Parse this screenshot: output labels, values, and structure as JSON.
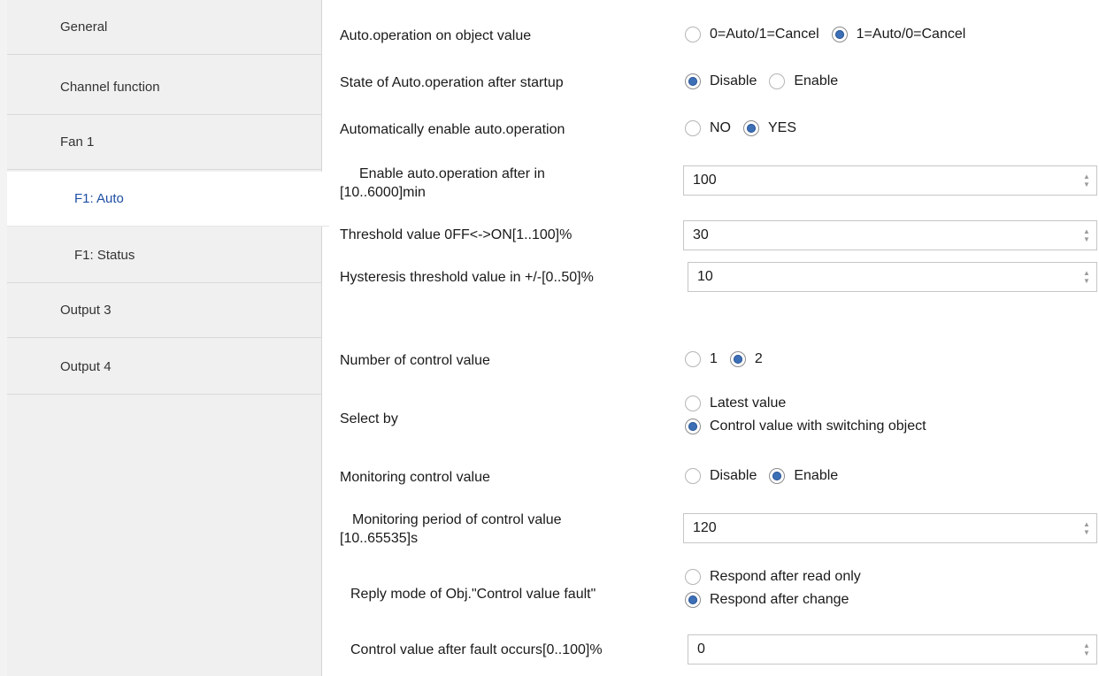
{
  "sidebar": {
    "items": [
      {
        "label": "General"
      },
      {
        "label": "Channel function"
      },
      {
        "label": "Fan 1"
      },
      {
        "label": "F1: Auto",
        "active": true
      },
      {
        "label": "F1: Status"
      },
      {
        "label": "Output 3"
      },
      {
        "label": "Output 4"
      }
    ]
  },
  "params": {
    "auto_op_object": {
      "label": "Auto.operation on object value",
      "options": [
        "0=Auto/1=Cancel",
        "1=Auto/0=Cancel"
      ],
      "selected": "1=Auto/0=Cancel"
    },
    "auto_op_startup": {
      "label": "State of Auto.operation after startup",
      "options": [
        "Disable",
        "Enable"
      ],
      "selected": "Disable"
    },
    "auto_enable": {
      "label": "Automatically enable auto.operation",
      "options": [
        "NO",
        "YES"
      ],
      "selected": "YES"
    },
    "enable_after": {
      "label_line1": "Enable auto.operation after in",
      "label_line2": "[10..6000]min",
      "value": "100"
    },
    "threshold": {
      "label": "Threshold value 0FF<->ON[1..100]%",
      "value": "30"
    },
    "hysteresis": {
      "label": "Hysteresis threshold value in +/-[0..50]%",
      "value": "10"
    },
    "num_control": {
      "label": "Number of control value",
      "options": [
        "1",
        "2"
      ],
      "selected": "2"
    },
    "select_by": {
      "label": "Select by",
      "options": [
        "Latest value",
        "Control value with switching object"
      ],
      "selected": "Control value with switching object"
    },
    "monitoring": {
      "label": "Monitoring control value",
      "options": [
        "Disable",
        "Enable"
      ],
      "selected": "Enable"
    },
    "monitoring_period": {
      "label_line1": "Monitoring period of control value",
      "label_line2": "[10..65535]s",
      "value": "120"
    },
    "reply_mode": {
      "label": "Reply mode of Obj.\"Control value fault\"",
      "options": [
        "Respond after read only",
        "Respond after change"
      ],
      "selected": "Respond after change"
    },
    "fault_value": {
      "label": "Control value after fault occurs[0..100]%",
      "value": "0"
    }
  }
}
